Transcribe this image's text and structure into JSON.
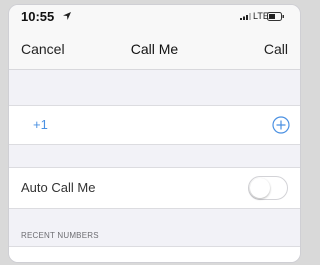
{
  "status_bar": {
    "time": "10:55",
    "network": "LTE"
  },
  "nav": {
    "cancel_label": "Cancel",
    "title": "Call Me",
    "call_label": "Call"
  },
  "phone_entry": {
    "prefix": "+1",
    "value": ""
  },
  "auto_call": {
    "label": "Auto Call Me",
    "enabled": false
  },
  "recent": {
    "header": "RECENT NUMBERS"
  },
  "colors": {
    "accent": "#4a90e2",
    "background": "#f2f2f7"
  },
  "icons": [
    "location-arrow-icon",
    "signal-icon",
    "battery-icon",
    "add-circle-icon"
  ]
}
